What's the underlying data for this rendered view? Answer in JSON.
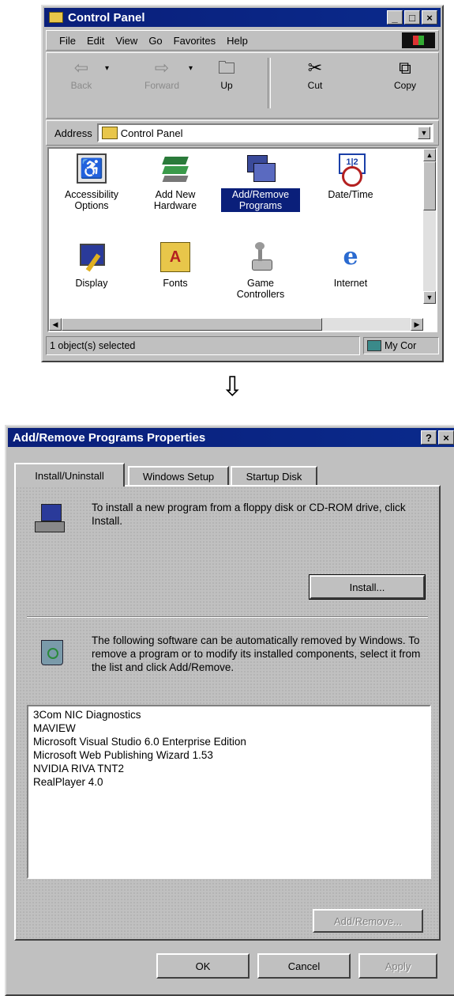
{
  "control_panel": {
    "title": "Control Panel",
    "menu": [
      "File",
      "Edit",
      "View",
      "Go",
      "Favorites",
      "Help"
    ],
    "toolbar": {
      "back": "Back",
      "forward": "Forward",
      "up": "Up",
      "cut": "Cut",
      "copy": "Copy"
    },
    "address_label": "Address",
    "address_value": "Control Panel",
    "icons": [
      {
        "label": "Accessibility Options",
        "selected": false
      },
      {
        "label": "Add New Hardware",
        "selected": false
      },
      {
        "label": "Add/Remove Programs",
        "selected": true
      },
      {
        "label": "Date/Time",
        "selected": false
      },
      {
        "label": "Display",
        "selected": false
      },
      {
        "label": "Fonts",
        "selected": false
      },
      {
        "label": "Game Controllers",
        "selected": false
      },
      {
        "label": "Internet",
        "selected": false
      }
    ],
    "status_left": "1 object(s) selected",
    "status_right": "My Cor"
  },
  "arrow_glyph": "⇩",
  "dialog": {
    "title": "Add/Remove Programs Properties",
    "help_btn": "?",
    "close_btn": "×",
    "tabs": [
      "Install/Uninstall",
      "Windows Setup",
      "Startup Disk"
    ],
    "install_text": "To install a new program from a floppy disk or CD-ROM drive, click Install.",
    "install_button": "Install...",
    "remove_text": "The following software can be automatically removed by Windows. To remove a program or to modify its installed components, select it from the list and click Add/Remove.",
    "programs": [
      "3Com NIC Diagnostics",
      "MAVIEW",
      "Microsoft Visual Studio 6.0 Enterprise Edition",
      "Microsoft Web Publishing Wizard 1.53",
      "NVIDIA RIVA TNT2",
      "RealPlayer 4.0"
    ],
    "add_remove_button": "Add/Remove...",
    "ok_button": "OK",
    "cancel_button": "Cancel",
    "apply_button": "Apply"
  }
}
